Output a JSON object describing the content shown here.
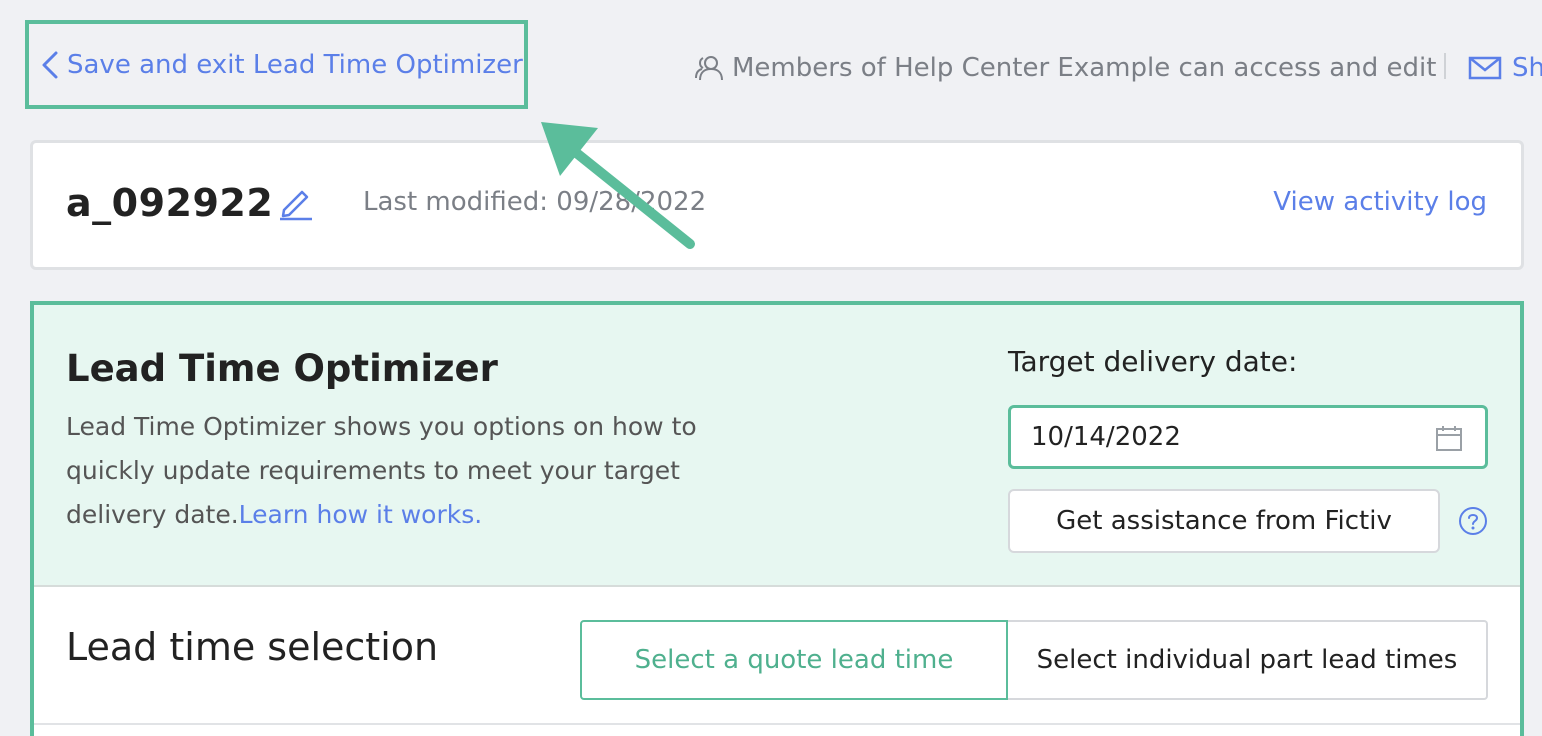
{
  "topbar": {
    "back_label": "Save and exit Lead Time Optimizer",
    "access_text": "Members of Help Center Example can access and edit",
    "share_label": "Sh"
  },
  "header": {
    "quote_id": "a_092922",
    "last_modified": "Last modified: 09/28/2022",
    "activity_link": "View activity log"
  },
  "optimizer": {
    "title": "Lead Time Optimizer",
    "description": "Lead Time Optimizer shows you options on how to quickly update requirements to meet your target delivery date.",
    "learn_link": "Learn how it works.",
    "target_label": "Target delivery date:",
    "target_date": "10/14/2022",
    "assist_button": "Get assistance from Fictiv"
  },
  "lead_time": {
    "title": "Lead time selection",
    "options": [
      "Select a quote lead time",
      "Select individual part lead times"
    ],
    "selected": "Select a quote lead time"
  },
  "colors": {
    "accent_green": "#5bbd9b",
    "link_blue": "#5b7fe8",
    "panel_bg": "#e7f7f1"
  }
}
